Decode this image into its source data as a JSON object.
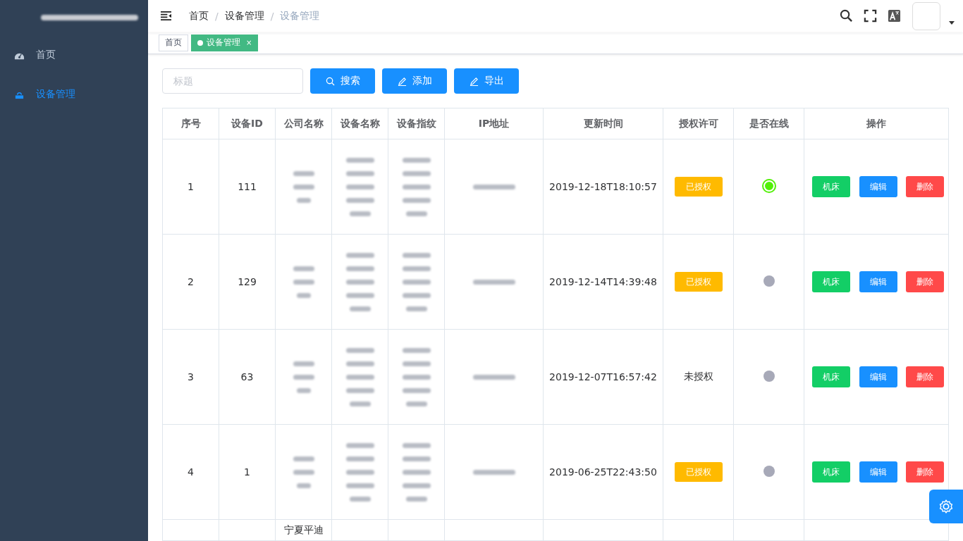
{
  "sidebar": {
    "title": {
      "redacted": true
    },
    "items": [
      {
        "label": "首页",
        "selected": false
      },
      {
        "label": "设备管理",
        "selected": true
      }
    ]
  },
  "breadcrumb": {
    "separator": "/",
    "items": [
      "首页",
      "设备管理",
      "设备管理"
    ]
  },
  "tags": [
    {
      "label": "首页",
      "selected": false
    },
    {
      "label": "设备管理",
      "selected": true,
      "close": "×"
    }
  ],
  "toolbar": {
    "search": {
      "placeholder": "标题"
    },
    "buttons": [
      {
        "label": "搜索"
      },
      {
        "label": "添加"
      },
      {
        "label": "导出"
      }
    ]
  },
  "table": {
    "columns": [
      "序号",
      "设备ID",
      "公司名称",
      "设备名称",
      "设备指纹",
      "IP地址",
      "更新时间",
      "授权许可",
      "是否在线",
      "操作"
    ],
    "rows": [
      {
        "index": "1",
        "device_id": "111",
        "company": {
          "redacted": true
        },
        "device_name": {
          "redacted": true
        },
        "fingerprint": {
          "redacted": true
        },
        "ip": {
          "redacted": true
        },
        "updated": "2019-12-18T18:10:57",
        "license": "已授权",
        "licensed": true,
        "online": true,
        "actions": [
          "机床",
          "编辑",
          "删除"
        ]
      },
      {
        "index": "2",
        "device_id": "129",
        "company": {
          "redacted": true
        },
        "device_name": {
          "redacted": true
        },
        "fingerprint": {
          "redacted": true
        },
        "ip": {
          "redacted": true
        },
        "updated": "2019-12-14T14:39:48",
        "license": "已授权",
        "licensed": true,
        "online": false,
        "actions": [
          "机床",
          "编辑",
          "删除"
        ]
      },
      {
        "index": "3",
        "device_id": "63",
        "company": {
          "redacted": true
        },
        "device_name": {
          "redacted": true
        },
        "fingerprint": {
          "redacted": true
        },
        "ip": {
          "redacted": true
        },
        "updated": "2019-12-07T16:57:42",
        "license": "未授权",
        "licensed": false,
        "online": false,
        "actions": [
          "机床",
          "编辑",
          "删除"
        ]
      },
      {
        "index": "4",
        "device_id": "1",
        "company": {
          "redacted": true
        },
        "device_name": {
          "redacted": true
        },
        "fingerprint": {
          "redacted": true
        },
        "ip": {
          "redacted": true
        },
        "updated": "2019-06-25T22:43:50",
        "license": "已授权",
        "licensed": true,
        "online": false,
        "actions": [
          "机床",
          "编辑",
          "删除"
        ]
      }
    ],
    "partial_row": {
      "company": "宁夏平迪"
    }
  }
}
